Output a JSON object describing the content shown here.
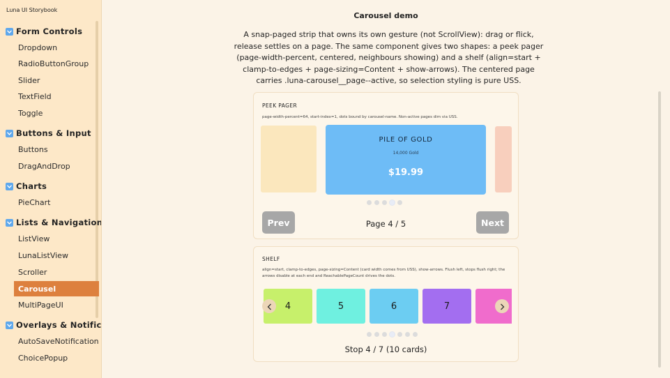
{
  "app_title": "Luna UI Storybook",
  "sidebar": {
    "groups": [
      {
        "label": "Form Controls",
        "items": [
          "Dropdown",
          "RadioButtonGroup",
          "Slider",
          "TextField",
          "Toggle"
        ]
      },
      {
        "label": "Buttons & Input",
        "items": [
          "Buttons",
          "DragAndDrop"
        ]
      },
      {
        "label": "Charts",
        "items": [
          "PieChart"
        ]
      },
      {
        "label": "Lists & Navigation",
        "items": [
          "ListView",
          "LunaListView",
          "Scroller",
          "Carousel",
          "MultiPageUI"
        ]
      },
      {
        "label": "Overlays & Notifica",
        "items": [
          "AutoSaveNotification",
          "ChoicePopup"
        ]
      }
    ],
    "active_item": "Carousel"
  },
  "main": {
    "title": "Carousel demo",
    "description": "A snap-paged strip that owns its own gesture (not ScrollView): drag or flick, release settles on a page. The same component gives two shapes: a peek pager (page-width-percent, centered, neighbours showing) and a shelf (align=start + clamp-to-edges + page-sizing=Content + show-arrows). The centered page carries .luna-carousel__page--active, so selection styling is pure USS."
  },
  "peek": {
    "heading": "PEEK PAGER",
    "sub": "page-width-percent=64, start-index=1, dots bound by carousel-name. Non-active pages dim via USS.",
    "page_title": "PILE OF GOLD",
    "page_sub": "14,000 Gold",
    "page_price": "$19.99",
    "prev_label": "Prev",
    "next_label": "Next",
    "page_indicator": "Page 4 / 5",
    "dot_count": 5,
    "active_dot": 4
  },
  "shelf": {
    "heading": "SHELF",
    "sub": "align=start, clamp-to-edges, page-sizing=Content (card width comes from USS), show-arrows. Flush left, stops flush right; the arrows disable at each end and ReachablePageCount drives the dots.",
    "cards": [
      {
        "label": "4",
        "color": "#c7f06b"
      },
      {
        "label": "5",
        "color": "#6ff0e0"
      },
      {
        "label": "6",
        "color": "#6ccdf2"
      },
      {
        "label": "7",
        "color": "#a36ef0"
      },
      {
        "label": "",
        "color": "#f06ccc"
      }
    ],
    "stop_indicator": "Stop 4 / 7 (10 cards)",
    "dot_count": 7,
    "active_dot": 4
  },
  "colors": {
    "sidebar_bg": "#fde8c8",
    "active_item": "#dd803e",
    "page_bg": "#fbf3e7",
    "active_page": "#6ebcf6",
    "button_gray": "#a7a7a7"
  }
}
